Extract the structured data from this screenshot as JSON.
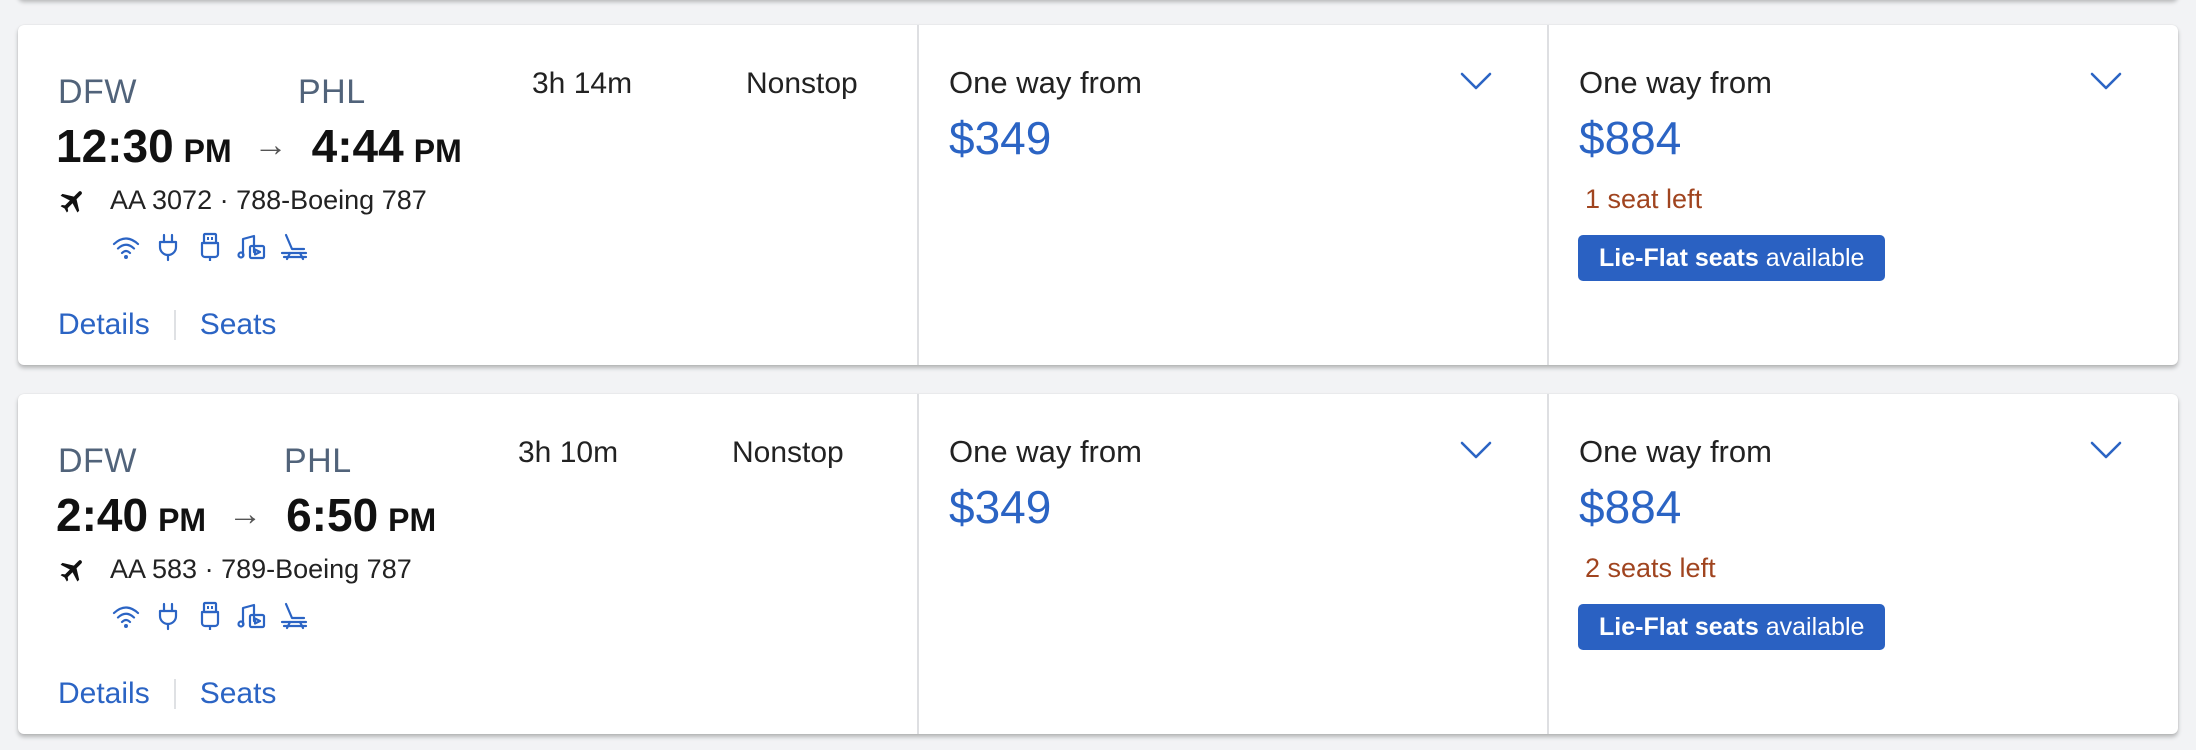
{
  "colors": {
    "accent": "#2b64c4",
    "badge_bg": "#2a61c2",
    "seats_warning": "#a0441f",
    "airport_text": "#51637a"
  },
  "flights": [
    {
      "origin": "DFW",
      "destination": "PHL",
      "depart_time": "12:30",
      "depart_ampm": "PM",
      "arrow": "→",
      "arrive_time": "4:44",
      "arrive_ampm": "PM",
      "duration": "3h 14m",
      "stops": "Nonstop",
      "flight_info": "AA 3072 · 788-Boeing 787",
      "amenities": [
        "wifi-icon",
        "power-outlet-icon",
        "usb-icon",
        "entertainment-icon",
        "lie-flat-seat-icon"
      ],
      "details_label": "Details",
      "seats_label": "Seats",
      "fares": [
        {
          "label": "One way from",
          "price": "$349"
        },
        {
          "label": "One way from",
          "price": "$884",
          "seats_left": "1 seat left",
          "badge_bold": "Lie-Flat seats",
          "badge_rest": "available"
        }
      ]
    },
    {
      "origin": "DFW",
      "destination": "PHL",
      "depart_time": "2:40",
      "depart_ampm": "PM",
      "arrow": "→",
      "arrive_time": "6:50",
      "arrive_ampm": "PM",
      "duration": "3h 10m",
      "stops": "Nonstop",
      "flight_info": "AA 583 · 789-Boeing 787",
      "amenities": [
        "wifi-icon",
        "power-outlet-icon",
        "usb-icon",
        "entertainment-icon",
        "lie-flat-seat-icon"
      ],
      "details_label": "Details",
      "seats_label": "Seats",
      "fares": [
        {
          "label": "One way from",
          "price": "$349"
        },
        {
          "label": "One way from",
          "price": "$884",
          "seats_left": "2 seats left",
          "badge_bold": "Lie-Flat seats",
          "badge_rest": "available"
        }
      ]
    }
  ]
}
